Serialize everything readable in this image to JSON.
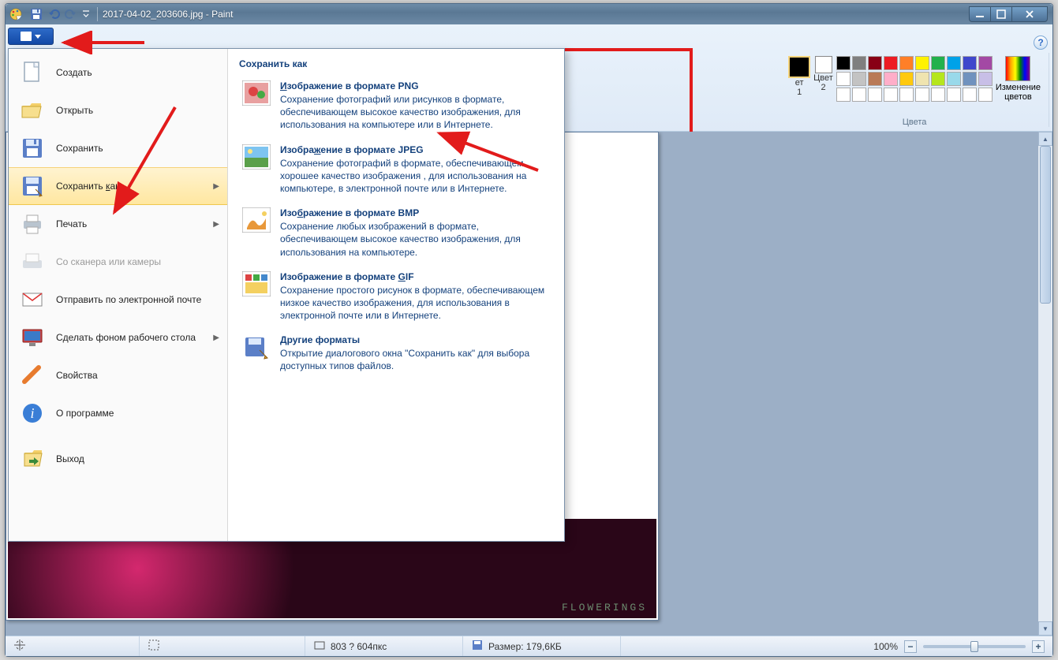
{
  "title": "2017-04-02_203606.jpg - Paint",
  "ribbon": {
    "color1_label_part1": "ет",
    "color1_label_part2": "1",
    "color2_label_line1": "Цвет",
    "color2_label_line2": "2",
    "edit_colors_line1": "Изменение",
    "edit_colors_line2": "цветов",
    "colors_group": "Цвета",
    "palette_row1": [
      "#000000",
      "#7f7f7f",
      "#880015",
      "#ed1c24",
      "#ff7f27",
      "#fff200",
      "#22b14c",
      "#00a2e8",
      "#3f48cc",
      "#a349a4"
    ],
    "palette_row2": [
      "#ffffff",
      "#c3c3c3",
      "#b97a57",
      "#ffaec9",
      "#ffc90e",
      "#efe4b0",
      "#b5e61d",
      "#99d9ea",
      "#7092be",
      "#c8bfe7"
    ],
    "palette_row3": [
      "#ffffff",
      "#ffffff",
      "#ffffff",
      "#ffffff",
      "#ffffff",
      "#ffffff",
      "#ffffff",
      "#ffffff",
      "#ffffff",
      "#ffffff"
    ]
  },
  "menu": {
    "new": "Создать",
    "open": "Открыть",
    "save": "Сохранить",
    "save_as": "Сохранить как",
    "print": "Печать",
    "scanner": "Со сканера или камеры",
    "email": "Отправить по электронной почте",
    "wallpaper": "Сделать фоном рабочего стола",
    "properties": "Свойства",
    "about": "О программе",
    "exit": "Выход"
  },
  "submenu": {
    "header": "Сохранить как",
    "png_title": "Изображение в формате PNG",
    "png_desc": "Сохранение фотографий или рисунков в формате, обеспечивающем высокое качество изображения, для использования на компьютере или в Интернете.",
    "jpeg_title": "Изображение в формате JPEG",
    "jpeg_desc": "Сохранение фотографий в формате, обеспечивающем хорошее качество изображения , для использования на компьютере, в электронной почте или в Интернете.",
    "bmp_title": "Изображение в формате BMP",
    "bmp_desc": "Сохранение любых изображений в формате, обеспечивающем высокое качество изображения, для использования на компьютере.",
    "gif_title": "Изображение в формате GIF",
    "gif_desc": "Сохранение простого рисунок в формате, обеспечивающем низкое качество изображения, для использования в электронной почте или в Интернете.",
    "other_title": "Другие форматы",
    "other_desc": "Открытие диалогового окна \"Сохранить как\" для выбора доступных типов файлов."
  },
  "status": {
    "dimensions": "803 ? 604пкс",
    "size": "Размер: 179,6КБ",
    "zoom": "100%"
  },
  "photo_watermark": "FLOWERINGS",
  "help": "?"
}
